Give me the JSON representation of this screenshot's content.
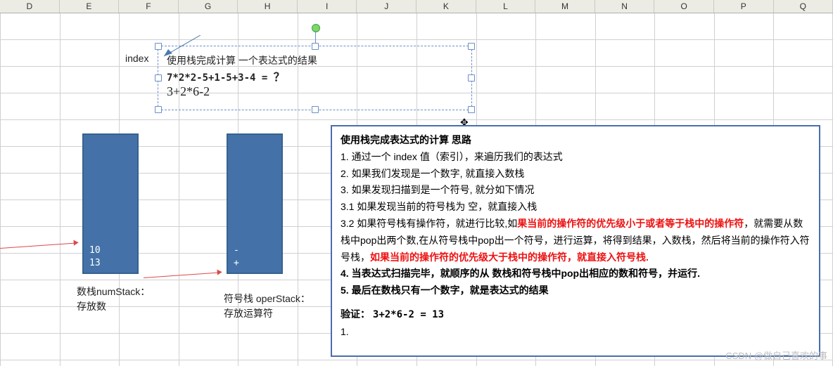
{
  "columns": [
    "D",
    "E",
    "F",
    "G",
    "H",
    "I",
    "J",
    "K",
    "L",
    "M",
    "N",
    "O",
    "P",
    "Q"
  ],
  "labels": {
    "index": "index"
  },
  "textbox": {
    "line1": "使用栈完成计算 一个表达式的结果",
    "line2_left": "7*2*2-5+1-5+3-4 = ",
    "line2_q": "？",
    "line3": "3+2*6-2"
  },
  "numStack": {
    "values": [
      "10",
      "13"
    ],
    "caption1": "数栈numStack：",
    "caption2": "存放数"
  },
  "operStack": {
    "values": [
      "-",
      "+"
    ],
    "caption1": "符号栈 operStack：",
    "caption2": "存放运算符"
  },
  "panel": {
    "title": "使用栈完成表达式的计算 思路",
    "p1": "1. 通过一个 index 值（索引），来遍历我们的表达式",
    "p2": "2. 如果我们发现是一个数字, 就直接入数栈",
    "p3": "3. 如果发现扫描到是一个符号, 就分如下情况",
    "p31": "3.1 如果发现当前的符号栈为 空，就直接入栈",
    "p32a": "3.2 如果符号栈有操作符，就进行比较,如",
    "p32red1": "果当前的操作符的优先级小于或者等于栈中的操作符",
    "p32b": "，就需要从数栈中pop出两个数,在从符号栈中pop出一个符号，进行运算，将得到结果，入数栈，然后将当前的操作符入符号栈，",
    "p32red2": "如果当前的操作符的优先级大于栈中的操作符，就直接入符号栈.",
    "p4": "4. 当表达式扫描完毕，就顺序的从 数栈和符号栈中pop出相应的数和符号，并运行.",
    "p5": "5. 最后在数栈只有一个数字，就是表达式的结果",
    "verify_label": "验证：",
    "verify_expr": "3+2*6-2 = 13",
    "verify_last": "1."
  },
  "watermark": "CSDN @做自己喜欢的事"
}
